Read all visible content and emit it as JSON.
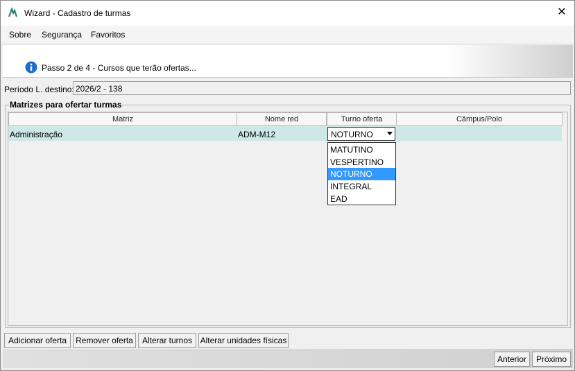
{
  "window": {
    "title": "Wizard - Cadastro de turmas",
    "close_glyph": "✕"
  },
  "menu": {
    "items": [
      "Sobre",
      "Segurança",
      "Favoritos"
    ]
  },
  "banner": {
    "step_text": "Passo 2 de 4 - Cursos que terão ofertas..."
  },
  "period": {
    "label": "Período L. destino:",
    "value": "2026/2 - 138"
  },
  "group": {
    "title": "Matrizes para ofertar turmas"
  },
  "table": {
    "columns": [
      "Matriz",
      "Nome red",
      "Turno oferta",
      "Câmpus/Polo"
    ],
    "rows": [
      {
        "matriz": "Administração",
        "nome_red": "ADM-M12",
        "turno": "NOTURNO",
        "campus": ""
      }
    ]
  },
  "dropdown": {
    "options": [
      "MATUTINO",
      "VESPERTINO",
      "NOTURNO",
      "INTEGRAL",
      "EAD"
    ],
    "selected": "NOTURNO"
  },
  "actions": {
    "add": "Adicionar oferta",
    "remove": "Remover oferta",
    "alter_turnos": "Alterar turnos",
    "alter_unidades": "Alterar unidades físicas"
  },
  "nav": {
    "prev": "Anterior",
    "next": "Próximo"
  },
  "colors": {
    "row_selected": "#cde8e6",
    "option_selected": "#3399ff",
    "info_icon": "#1e6fc8"
  }
}
